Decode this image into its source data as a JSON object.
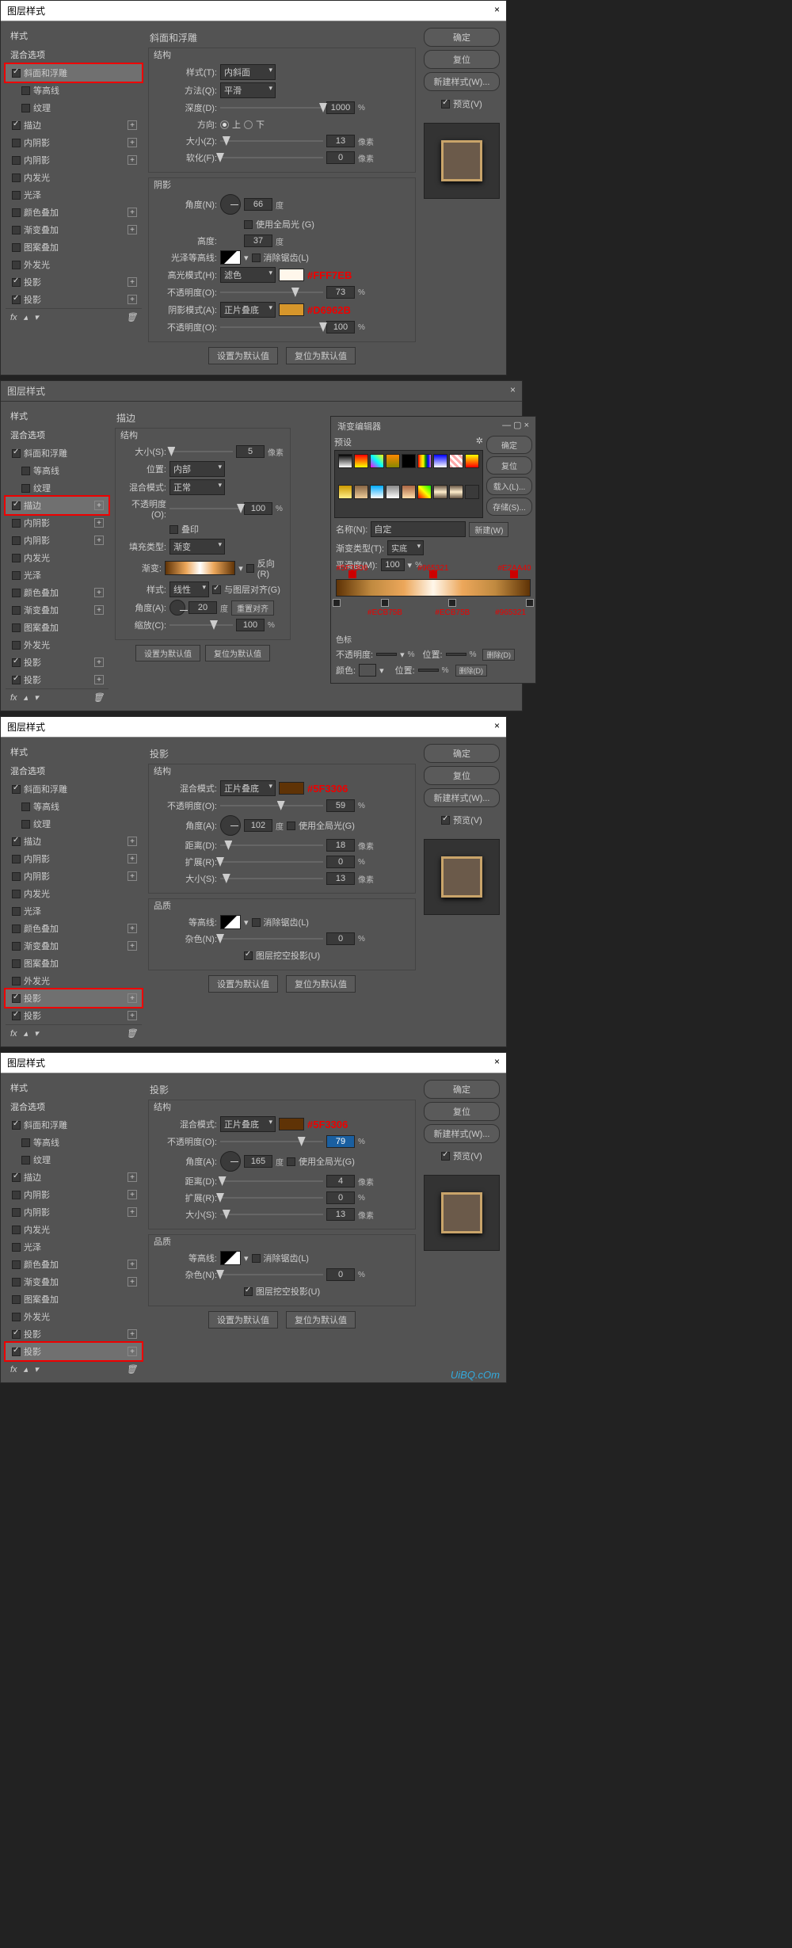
{
  "common": {
    "title": "图层样式",
    "close": "×",
    "style_header": "样式",
    "blend_options": "混合选项",
    "effects": {
      "bevel": "斜面和浮雕",
      "contour": "等高线",
      "texture": "纹理",
      "stroke": "描边",
      "inner_shadow": "内阴影",
      "inner_glow": "内发光",
      "satin": "光泽",
      "color_overlay": "颜色叠加",
      "gradient_overlay": "渐变叠加",
      "pattern_overlay": "图案叠加",
      "outer_glow": "外发光",
      "drop_shadow": "投影"
    },
    "fx": "fx",
    "ok": "确定",
    "reset": "复位",
    "new_style": "新建样式(W)...",
    "preview": "预览(V)",
    "set_default": "设置为默认值",
    "reset_default": "复位为默认值",
    "px": "像素",
    "pct": "%",
    "deg": "度"
  },
  "p1": {
    "section": "斜面和浮雕",
    "structure": "结构",
    "style_lbl": "样式(T):",
    "style_val": "内斜面",
    "technique_lbl": "方法(Q):",
    "technique_val": "平滑",
    "depth_lbl": "深度(D):",
    "depth_val": "1000",
    "direction_lbl": "方向:",
    "up": "上",
    "down": "下",
    "size_lbl": "大小(Z):",
    "size_val": "13",
    "soften_lbl": "软化(F):",
    "soften_val": "0",
    "shading": "阴影",
    "angle_lbl": "角度(N):",
    "angle_val": "66",
    "global": "使用全局光 (G)",
    "altitude_lbl": "高度:",
    "altitude_val": "37",
    "gloss_lbl": "光泽等高线:",
    "anti": "消除锯齿(L)",
    "hmode_lbl": "高光模式(H):",
    "hmode_val": "滤色",
    "h_hex": "#FFF7EB",
    "opac_lbl": "不透明度(O):",
    "h_opac": "73",
    "smode_lbl": "阴影模式(A):",
    "smode_val": "正片叠底",
    "s_hex": "#D6962B",
    "s_opac": "100"
  },
  "p2": {
    "title": "图层样式",
    "section": "描边",
    "structure": "结构",
    "size_lbl": "大小(S):",
    "size_val": "5",
    "pos_lbl": "位置:",
    "pos_val": "内部",
    "blend_lbl": "混合模式:",
    "blend_val": "正常",
    "opac_lbl": "不透明度(O):",
    "opac_val": "100",
    "overprint": "叠印",
    "fill_lbl": "填充类型:",
    "fill_val": "渐变",
    "grad_lbl": "渐变:",
    "reverse": "反向(R)",
    "style_lbl": "样式:",
    "style_val": "线性",
    "align": "与图层对齐(G)",
    "angle_lbl": "角度(A):",
    "angle_val": "20",
    "reset_align": "重置对齐",
    "scale_lbl": "缩放(C):",
    "scale_val": "100",
    "ge_title": "渐变编辑器",
    "presets": "预设",
    "gear": "✲",
    "name_lbl": "名称(N):",
    "name_val": "自定",
    "new_btn": "新建(W)",
    "gtype_lbl": "渐变类型(T):",
    "gtype_val": "实底",
    "smooth_lbl": "平滑度(M):",
    "smooth_val": "100",
    "stops_top": [
      "#5F3306",
      "#965321",
      "#E2AA40"
    ],
    "stops_bot": [
      "#ECB75B",
      "#ECB75B",
      "#965321"
    ],
    "color_stops": "色标",
    "opac_s": "不透明度:",
    "loc_s": "位置:",
    "del_s": "删除(D)",
    "color_s": "颜色:",
    "load": "载入(L)...",
    "save": "存储(S)..."
  },
  "p3": {
    "section": "投影",
    "structure": "结构",
    "blend_lbl": "混合模式:",
    "blend_val": "正片叠底",
    "hex": "#5F3306",
    "opac_lbl": "不透明度(O):",
    "opac_val": "59",
    "angle_lbl": "角度(A):",
    "angle_val": "102",
    "global": "使用全局光(G)",
    "dist_lbl": "距离(D):",
    "dist_val": "18",
    "spread_lbl": "扩展(R):",
    "spread_val": "0",
    "size_lbl": "大小(S):",
    "size_val": "13",
    "quality": "品质",
    "contour_lbl": "等高线:",
    "anti": "消除锯齿(L)",
    "noise_lbl": "杂色(N):",
    "noise_val": "0",
    "knockout": "图层挖空投影(U)"
  },
  "p4": {
    "section": "投影",
    "structure": "结构",
    "blend_lbl": "混合模式:",
    "blend_val": "正片叠底",
    "hex": "#5F3306",
    "opac_lbl": "不透明度(O):",
    "opac_val": "79",
    "angle_lbl": "角度(A):",
    "angle_val": "165",
    "global": "使用全局光(G)",
    "dist_lbl": "距离(D):",
    "dist_val": "4",
    "spread_lbl": "扩展(R):",
    "spread_val": "0",
    "size_lbl": "大小(S):",
    "size_val": "13",
    "quality": "品质",
    "contour_lbl": "等高线:",
    "anti": "消除锯齿(L)",
    "noise_lbl": "杂色(N):",
    "noise_val": "0",
    "knockout": "图层挖空投影(U)",
    "watermark": "UiBQ.cOm"
  }
}
